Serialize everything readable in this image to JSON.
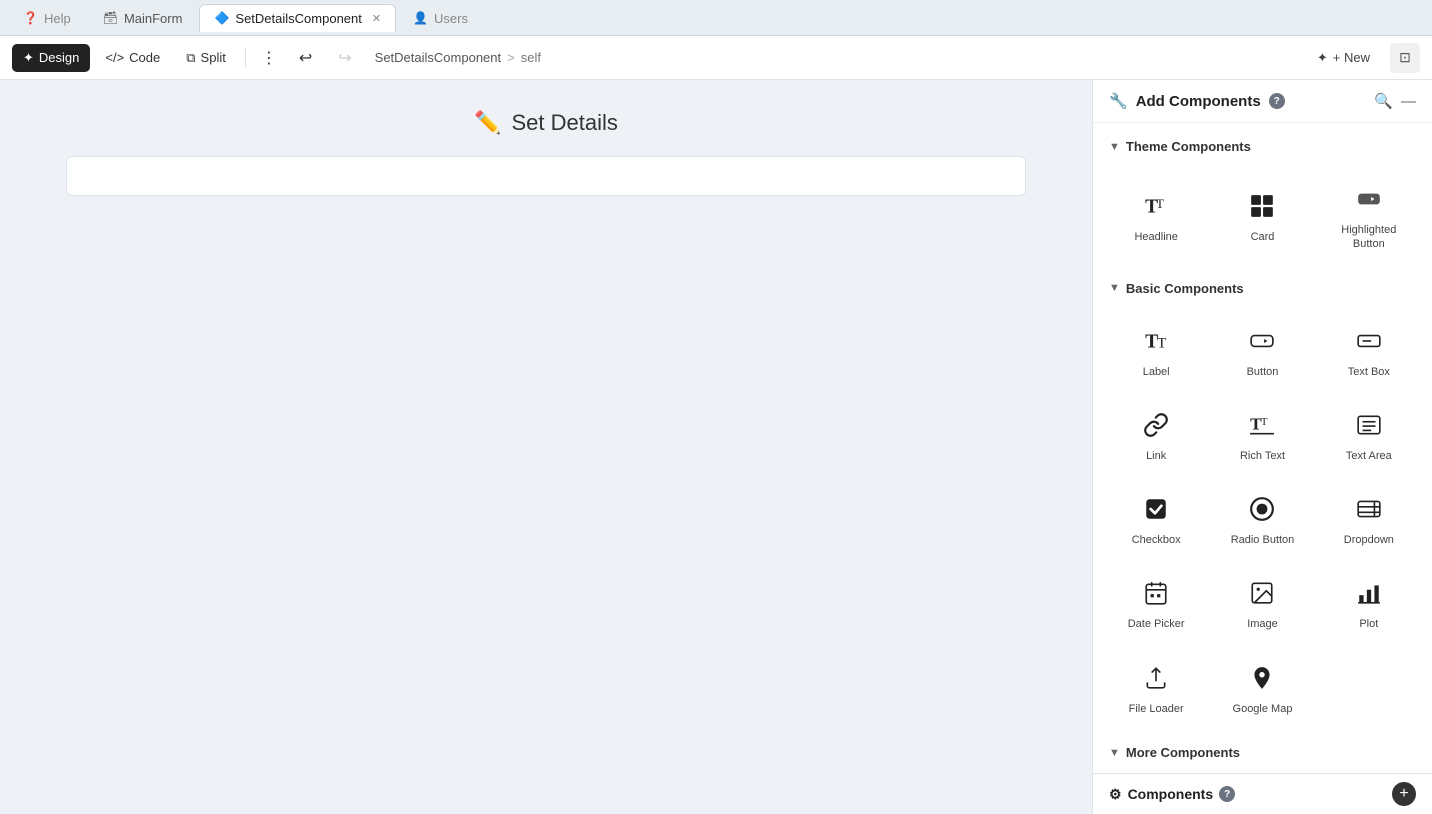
{
  "tabs": [
    {
      "id": "help",
      "label": "Help",
      "icon": "❓",
      "active": false,
      "closable": false
    },
    {
      "id": "mainform",
      "label": "MainForm",
      "icon": "🗃",
      "active": false,
      "closable": false
    },
    {
      "id": "setdetails",
      "label": "SetDetailsComponent",
      "icon": "🔷",
      "active": true,
      "closable": true
    },
    {
      "id": "users",
      "label": "Users",
      "icon": "👤",
      "active": false,
      "closable": false
    }
  ],
  "toolbar": {
    "design_label": "Design",
    "code_label": "Code",
    "split_label": "Split",
    "breadcrumb_component": "SetDetailsComponent",
    "breadcrumb_sep": ">",
    "breadcrumb_current": "self",
    "new_label": "+ New"
  },
  "canvas": {
    "title": "Set Details",
    "title_icon": "✏️"
  },
  "right_panel": {
    "title": "Add Components",
    "help_badge": "?",
    "sections": [
      {
        "id": "theme",
        "label": "Theme Components",
        "expanded": true,
        "components": [
          {
            "id": "headline",
            "label": "Headline",
            "icon": "headline"
          },
          {
            "id": "card",
            "label": "Card",
            "icon": "card"
          },
          {
            "id": "highlighted-button",
            "label": "Highlighted Button",
            "icon": "highlighted-button"
          }
        ]
      },
      {
        "id": "basic",
        "label": "Basic Components",
        "expanded": true,
        "components": [
          {
            "id": "label",
            "label": "Label",
            "icon": "label"
          },
          {
            "id": "button",
            "label": "Button",
            "icon": "button"
          },
          {
            "id": "text-box",
            "label": "Text Box",
            "icon": "text-box"
          },
          {
            "id": "link",
            "label": "Link",
            "icon": "link"
          },
          {
            "id": "rich-text",
            "label": "Rich Text",
            "icon": "rich-text"
          },
          {
            "id": "text-area",
            "label": "Text Area",
            "icon": "text-area"
          },
          {
            "id": "checkbox",
            "label": "Checkbox",
            "icon": "checkbox"
          },
          {
            "id": "radio-button",
            "label": "Radio Button",
            "icon": "radio-button"
          },
          {
            "id": "dropdown",
            "label": "Dropdown",
            "icon": "dropdown"
          },
          {
            "id": "date-picker",
            "label": "Date Picker",
            "icon": "date-picker"
          },
          {
            "id": "image",
            "label": "Image",
            "icon": "image"
          },
          {
            "id": "plot",
            "label": "Plot",
            "icon": "plot"
          },
          {
            "id": "file-loader",
            "label": "File Loader",
            "icon": "file-loader"
          },
          {
            "id": "google-map",
            "label": "Google Map",
            "icon": "google-map"
          }
        ]
      },
      {
        "id": "more",
        "label": "More Components",
        "expanded": false,
        "components": []
      }
    ]
  },
  "bottom_bar": {
    "label": "Components",
    "help_badge": "?"
  }
}
